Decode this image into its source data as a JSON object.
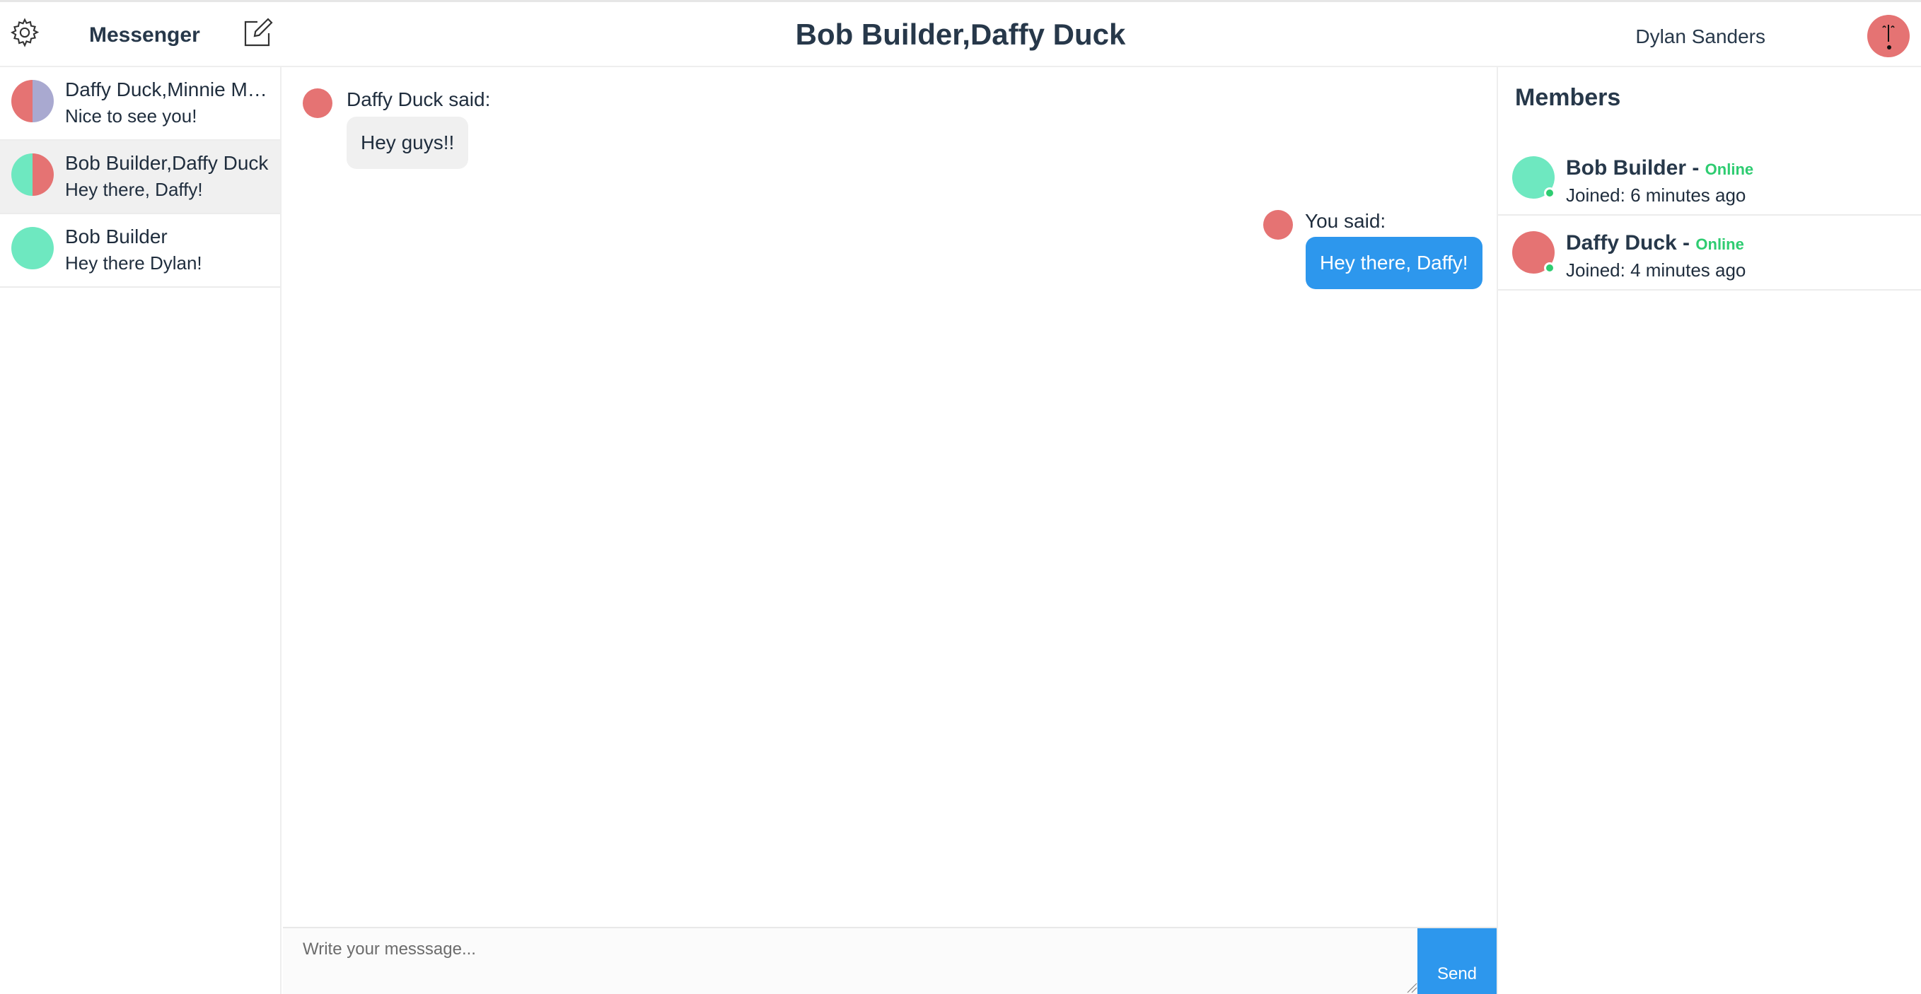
{
  "colors": {
    "accent": "#2d97ed",
    "online": "#2ecc71",
    "avatar_red": "#e57373",
    "avatar_green": "#6ee8c0",
    "avatar_lavender": "#a9a9d0",
    "active_row": "#f0f0f0"
  },
  "header": {
    "app_title": "Messenger",
    "settings_icon": "gear-icon",
    "compose_icon": "compose-icon",
    "conversation_title": "Bob Builder,Daffy Duck",
    "user_name": "Dylan Sanders"
  },
  "sidebar": {
    "conversations": [
      {
        "name": "Daffy Duck,Minnie Mouse",
        "preview": "Nice to see you!",
        "active": false
      },
      {
        "name": "Bob Builder,Daffy Duck",
        "preview": "Hey there, Daffy!",
        "active": true
      },
      {
        "name": "Bob Builder",
        "preview": "Hey there Dylan!",
        "active": false
      }
    ]
  },
  "chat": {
    "messages": [
      {
        "sender_label": "Daffy Duck said:",
        "text": "Hey guys!!",
        "from_me": false
      },
      {
        "sender_label": "You said:",
        "text": "Hey there, Daffy!",
        "from_me": true
      }
    ]
  },
  "composer": {
    "placeholder": "Write your messsage...",
    "send_label": "Send"
  },
  "members": {
    "title": "Members",
    "list": [
      {
        "name": "Bob Builder",
        "separator": " - ",
        "status": "Online",
        "joined": "Joined: 6 minutes ago"
      },
      {
        "name": "Daffy Duck",
        "separator": " - ",
        "status": "Online",
        "joined": "Joined: 4 minutes ago"
      }
    ]
  }
}
